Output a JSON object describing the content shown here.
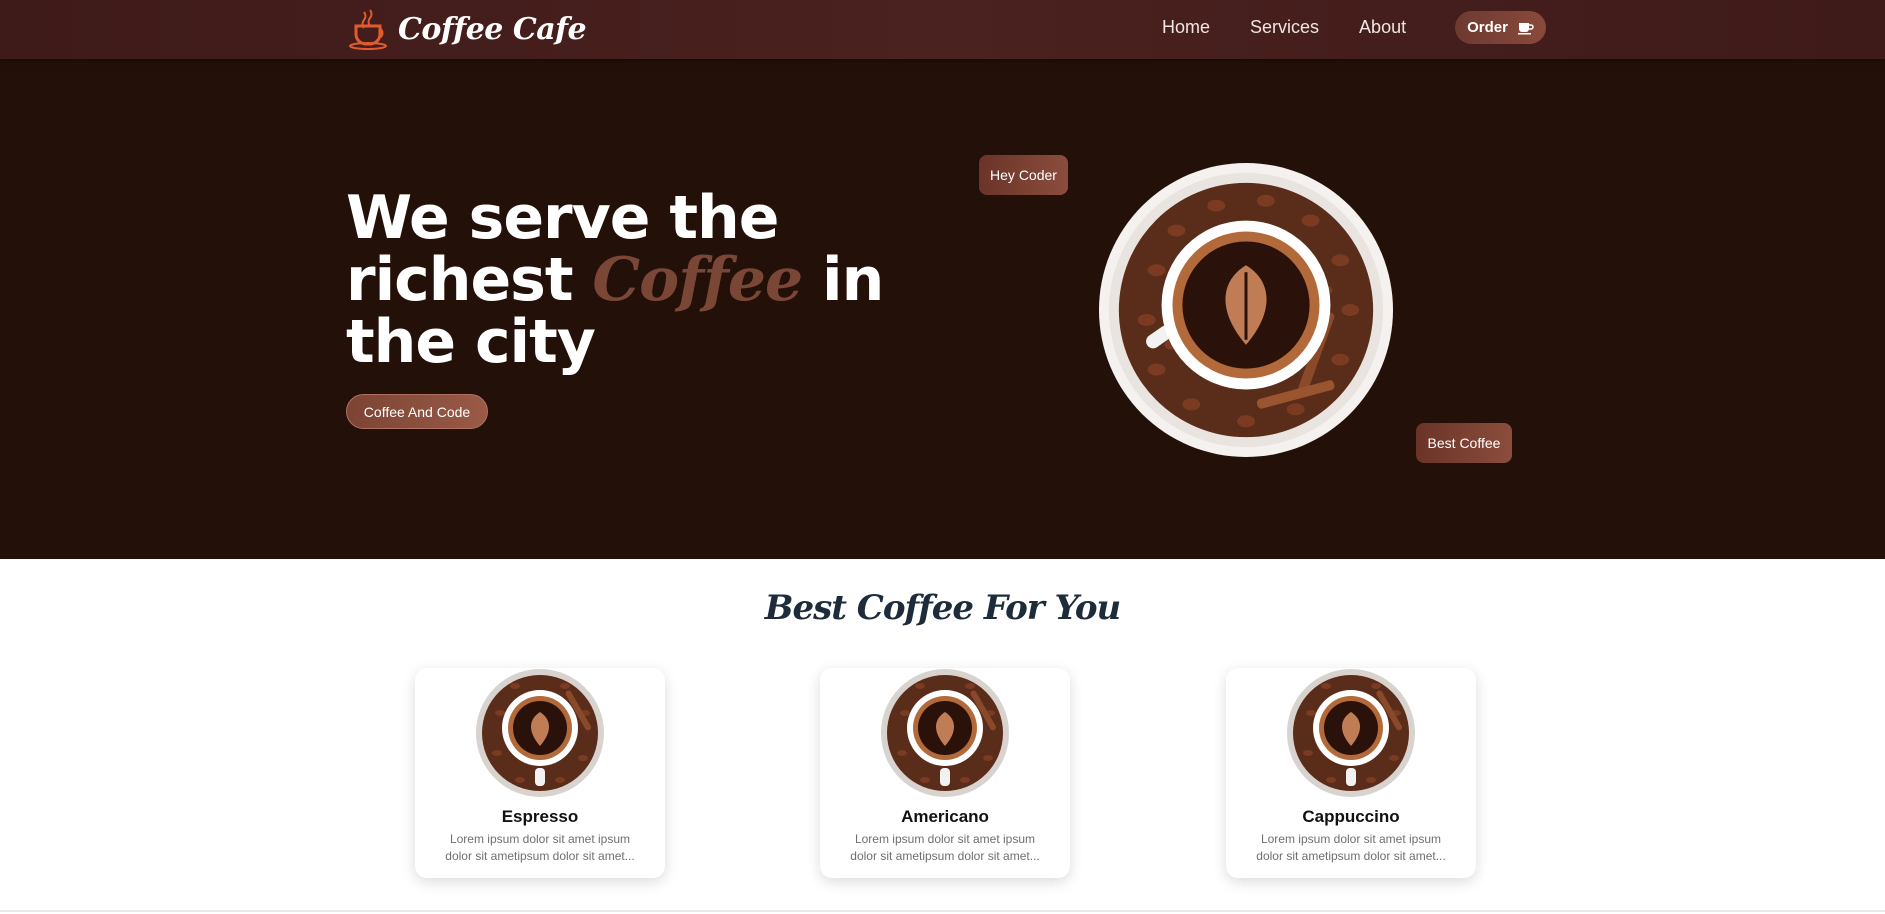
{
  "navbar": {
    "brand": "Coffee Cafe",
    "links": [
      "Home",
      "Services",
      "About"
    ],
    "order_label": "Order"
  },
  "hero": {
    "title_part1": "We serve the richest ",
    "title_accent": "Coffee",
    "title_part2": " in the city",
    "cta_label": "Coffee And Code",
    "tag_1": "Hey Coder",
    "tag_2": "Best Coffee"
  },
  "section": {
    "title": "Best Coffee For You",
    "cards": [
      {
        "name": "Espresso",
        "desc": "Lorem ipsum dolor sit amet ipsum dolor sit ametipsum dolor sit amet..."
      },
      {
        "name": "Americano",
        "desc": "Lorem ipsum dolor sit amet ipsum dolor sit ametipsum dolor sit amet..."
      },
      {
        "name": "Cappuccino",
        "desc": "Lorem ipsum dolor sit amet ipsum dolor sit ametipsum dolor sit amet..."
      }
    ]
  },
  "colors": {
    "nav_bg": "#4a2220",
    "hero_bg": "#231009",
    "accent": "#7a4736",
    "button": "#8a4a3b",
    "section_title": "#1d2b3a"
  },
  "icons": {
    "brand": "coffee-cup-logo-icon",
    "order": "coffee-cup-icon"
  }
}
